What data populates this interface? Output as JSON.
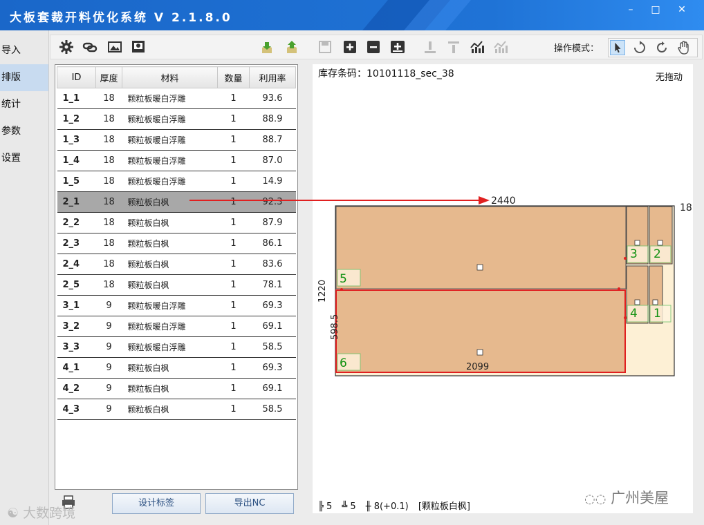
{
  "window": {
    "title": "大板套裁开料优化系统  V 2.1.8.0",
    "controls": [
      "–",
      "□",
      "✕"
    ]
  },
  "sidebar": {
    "items": [
      {
        "label": "导入"
      },
      {
        "label": "排版",
        "active": true
      },
      {
        "label": "统计"
      },
      {
        "label": "参数"
      },
      {
        "label": "设置"
      }
    ]
  },
  "toolbar": {
    "icons": [
      "gear-icon",
      "link-icon",
      "image-icon",
      "preview-icon",
      "import-icon",
      "export-icon",
      "save-icon",
      "add-icon",
      "remove-icon",
      "add-board-icon",
      "align-bottom-icon",
      "align-top-icon",
      "chart-icon",
      "chart-disabled-icon"
    ],
    "op_mode_label": "操作模式：",
    "op_modes": [
      "pointer-icon",
      "rotate-icon",
      "refresh-icon",
      "hand-icon"
    ]
  },
  "table": {
    "headers": [
      "ID",
      "厚度",
      "材料",
      "数量",
      "利用率"
    ],
    "rows": [
      {
        "id": "1_1",
        "thickness": "18",
        "material": "颗粒板暖白浮雕",
        "qty": "1",
        "usage": "93.6"
      },
      {
        "id": "1_2",
        "thickness": "18",
        "material": "颗粒板暖白浮雕",
        "qty": "1",
        "usage": "88.9"
      },
      {
        "id": "1_3",
        "thickness": "18",
        "material": "颗粒板暖白浮雕",
        "qty": "1",
        "usage": "88.7"
      },
      {
        "id": "1_4",
        "thickness": "18",
        "material": "颗粒板暖白浮雕",
        "qty": "1",
        "usage": "87.0"
      },
      {
        "id": "1_5",
        "thickness": "18",
        "material": "颗粒板暖白浮雕",
        "qty": "1",
        "usage": "14.9"
      },
      {
        "id": "2_1",
        "thickness": "18",
        "material": "颗粒板白枫",
        "qty": "1",
        "usage": "92.3",
        "selected": true
      },
      {
        "id": "2_2",
        "thickness": "18",
        "material": "颗粒板白枫",
        "qty": "1",
        "usage": "87.9"
      },
      {
        "id": "2_3",
        "thickness": "18",
        "material": "颗粒板白枫",
        "qty": "1",
        "usage": "86.1"
      },
      {
        "id": "2_4",
        "thickness": "18",
        "material": "颗粒板白枫",
        "qty": "1",
        "usage": "83.6"
      },
      {
        "id": "2_5",
        "thickness": "18",
        "material": "颗粒板白枫",
        "qty": "1",
        "usage": "78.1"
      },
      {
        "id": "3_1",
        "thickness": "9",
        "material": "颗粒板暖白浮雕",
        "qty": "1",
        "usage": "69.3"
      },
      {
        "id": "3_2",
        "thickness": "9",
        "material": "颗粒板暖白浮雕",
        "qty": "1",
        "usage": "69.1"
      },
      {
        "id": "3_3",
        "thickness": "9",
        "material": "颗粒板暖白浮雕",
        "qty": "1",
        "usage": "58.5"
      },
      {
        "id": "4_1",
        "thickness": "9",
        "material": "颗粒板白枫",
        "qty": "1",
        "usage": "69.3"
      },
      {
        "id": "4_2",
        "thickness": "9",
        "material": "颗粒板白枫",
        "qty": "1",
        "usage": "69.1"
      },
      {
        "id": "4_3",
        "thickness": "9",
        "material": "颗粒板白枫",
        "qty": "1",
        "usage": "58.5"
      }
    ]
  },
  "buttons": {
    "design_label": "设计标签",
    "export_nc": "导出NC"
  },
  "canvas": {
    "barcode": "库存条码：10101118_sec_38",
    "drag_mode": "无拖动",
    "board_width": "2440",
    "board_thickness": "18",
    "board_height": "1220",
    "piece_height": "598.5",
    "piece_width": "2099",
    "pieces": [
      "3",
      "2",
      "4",
      "1",
      "5",
      "6"
    ]
  },
  "status": {
    "item1": "╠ 5",
    "item2": "╩ 5",
    "item3": "╫ 8(+0.1)",
    "material": "[颗粒板白枫]"
  },
  "watermark": {
    "right": "广州美屋",
    "left": "大数跨境"
  },
  "colors": {
    "title_bar": "#1f73d6",
    "board_fill": "#e6b98e",
    "waste_fill": "#fdf0d5",
    "highlight": "#e02020",
    "piece_number": "#129112"
  }
}
